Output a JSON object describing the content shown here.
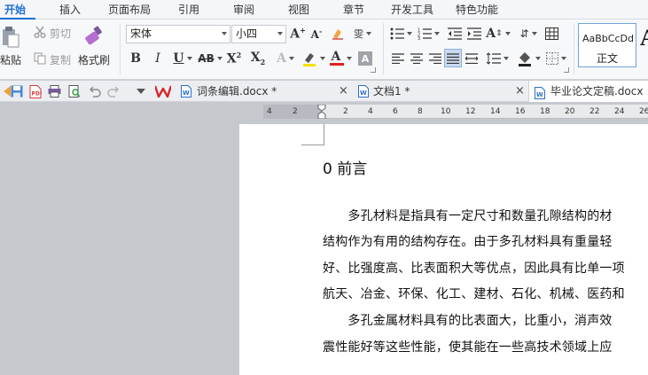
{
  "ribbon_tabs": [
    "开始",
    "插入",
    "页面布局",
    "引用",
    "审阅",
    "视图",
    "章节",
    "开发工具",
    "特色功能"
  ],
  "active_tab": "开始",
  "clipboard": {
    "paste_label": "粘贴",
    "cut_label": "剪切",
    "copy_label": "复制",
    "format_painter_label": "格式刷"
  },
  "font": {
    "family": "宋体",
    "size": "小四"
  },
  "styles": {
    "preview": "AaBbCcDd",
    "name": "正文",
    "next_preview": "A"
  },
  "document_tabs": [
    {
      "title": "词条编辑.docx *",
      "active": false
    },
    {
      "title": "文档1 *",
      "active": false
    },
    {
      "title": "毕业论文定稿.docx",
      "active": true
    }
  ],
  "ruler_ticks": [
    "4",
    "2",
    "2",
    "4",
    "6",
    "8",
    "10",
    "12",
    "14",
    "16",
    "18",
    "20",
    "22",
    "24",
    "26"
  ],
  "document": {
    "heading": "0  前言",
    "lines": [
      "　　多孔材料是指具有一定尺寸和数量孔隙结构的材",
      "结构作为有用的结构存在。由于多孔材料具有重量轻",
      "好、比强度高、比表面积大等优点，因此具有比单一项",
      "航天、冶金、环保、化工、建材、石化、机械、医药和",
      "　　多孔金属材料具有的比表面大，比重小，消声效",
      "震性能好等这些性能，使其能在一些高技术领域上应"
    ]
  },
  "colors": {
    "accent": "#1d6fd3",
    "page": "#ffffff",
    "workspace": "#c5c8cd"
  }
}
